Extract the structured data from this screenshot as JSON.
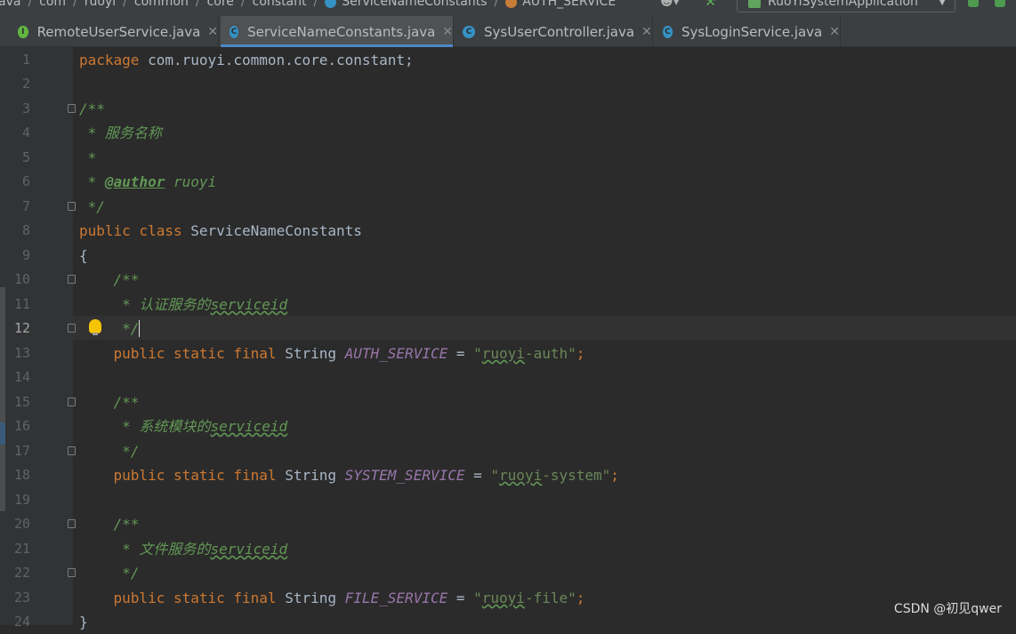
{
  "breadcrumb": {
    "items": [
      "ava",
      "com",
      "ruoyi",
      "common",
      "core",
      "constant",
      "ServiceNameConstants",
      "AUTH_SERVICE"
    ]
  },
  "toolbar": {
    "run_config": "RuoYiSystemApplication"
  },
  "tabs": [
    {
      "label": "RemoteUserService.java",
      "icon": "interface-icon",
      "active": false
    },
    {
      "label": "ServiceNameConstants.java",
      "icon": "class-icon",
      "active": true
    },
    {
      "label": "SysUserController.java",
      "icon": "class-icon",
      "active": false
    },
    {
      "label": "SysLoginService.java",
      "icon": "class-icon",
      "active": false
    }
  ],
  "editor": {
    "current_line": 12,
    "lines": [
      {
        "n": "1",
        "t": {
          "kw": "package ",
          "pl": "com.ruoyi.common.core.constant;"
        }
      },
      {
        "n": "2"
      },
      {
        "n": "3",
        "t": {
          "cm": "/**"
        }
      },
      {
        "n": "4",
        "t": {
          "cm": " * 服务名称"
        }
      },
      {
        "n": "5",
        "t": {
          "cm": " *"
        }
      },
      {
        "n": "6",
        "t": {
          "cm1": " * ",
          "tag": "@author",
          "cm2": " ruoyi"
        }
      },
      {
        "n": "7",
        "t": {
          "cm": " */"
        }
      },
      {
        "n": "8",
        "t": {
          "kw": "public class ",
          "pl": "ServiceNameConstants"
        }
      },
      {
        "n": "9",
        "t": {
          "pl": "{"
        }
      },
      {
        "n": "10",
        "t": {
          "cm": "    /**"
        }
      },
      {
        "n": "11",
        "t": {
          "cm": "     * 认证服务的",
          "sq": "serviceid"
        }
      },
      {
        "n": "12",
        "t": {
          "cm": "     */"
        }
      },
      {
        "n": "13",
        "t": {
          "kw": "public static final ",
          "type": "String ",
          "const": "AUTH_SERVICE",
          "eq": " = ",
          "q1": "\"",
          "sq": "ruoyi",
          "rest": "-auth\"",
          "semi": ";"
        }
      },
      {
        "n": "14"
      },
      {
        "n": "15",
        "t": {
          "cm": "    /**"
        }
      },
      {
        "n": "16",
        "t": {
          "cm": "     * 系统模块的",
          "sq": "serviceid"
        }
      },
      {
        "n": "17",
        "t": {
          "cm": "     */"
        }
      },
      {
        "n": "18",
        "t": {
          "kw": "public static final ",
          "type": "String ",
          "const": "SYSTEM_SERVICE",
          "eq": " = ",
          "q1": "\"",
          "sq": "ruoyi",
          "rest": "-system\"",
          "semi": ";"
        }
      },
      {
        "n": "19"
      },
      {
        "n": "20",
        "t": {
          "cm": "    /**"
        }
      },
      {
        "n": "21",
        "t": {
          "cm": "     * 文件服务的",
          "sq": "serviceid"
        }
      },
      {
        "n": "22",
        "t": {
          "cm": "     */"
        }
      },
      {
        "n": "23",
        "t": {
          "kw": "public static final ",
          "type": "String ",
          "const": "FILE_SERVICE",
          "eq": " = ",
          "q1": "\"",
          "sq": "ruoyi",
          "rest": "-file\"",
          "semi": ";"
        }
      },
      {
        "n": "24",
        "t": {
          "pl": "}"
        }
      }
    ]
  },
  "watermark": "CSDN @初见qwer"
}
